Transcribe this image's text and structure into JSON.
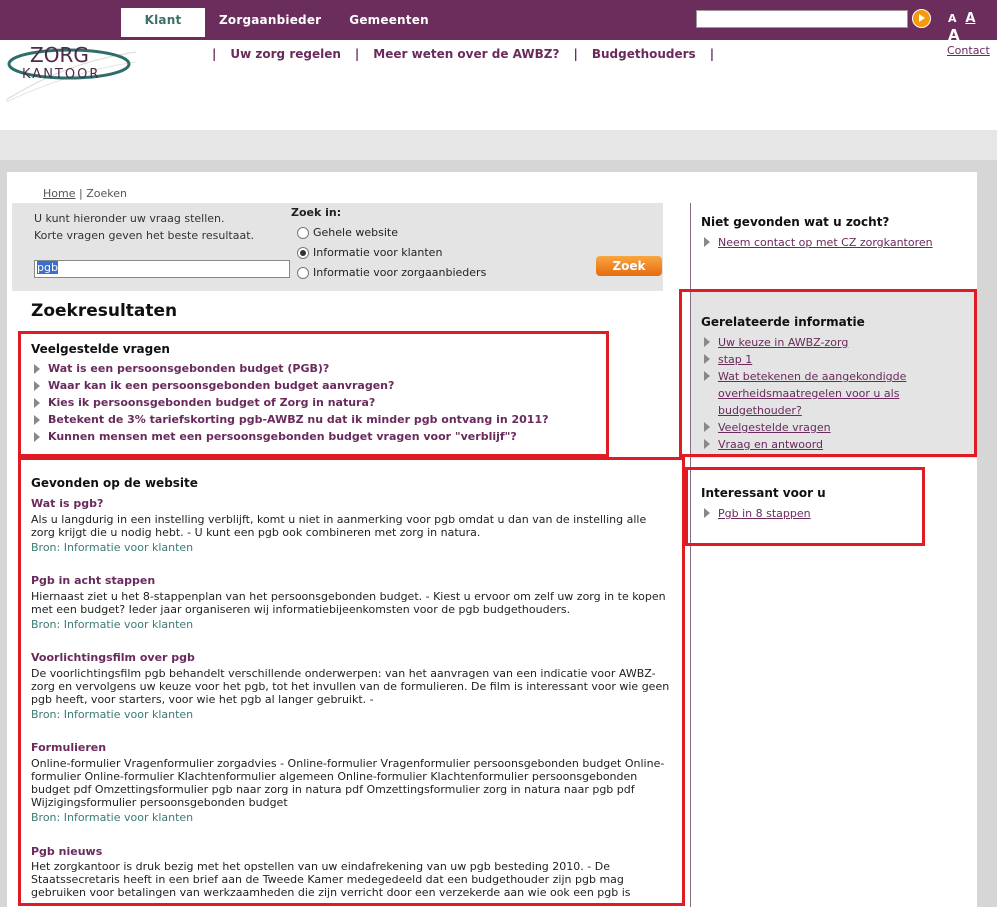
{
  "topnav": {
    "tabs": [
      "Klant",
      "Zorgaanbieder",
      "Gemeenten"
    ],
    "font_sizes": [
      "A",
      "A",
      "A"
    ]
  },
  "logo": {
    "line1": "ZORG",
    "line2": "KANTOOR"
  },
  "mainnav": {
    "items": [
      "Uw zorg regelen",
      "Meer weten over de AWBZ?",
      "Budgethouders"
    ],
    "separator": "|"
  },
  "contact": "Contact",
  "breadcrumb": {
    "home": "Home",
    "sep": "|",
    "current": "Zoeken"
  },
  "search": {
    "intro_line1": "U kunt hieronder uw vraag stellen.",
    "intro_line2": "Korte vragen geven het beste resultaat.",
    "query": "pgb",
    "zoek_in_label": "Zoek in:",
    "options": [
      "Gehele website",
      "Informatie voor klanten",
      "Informatie voor zorgaanbieders"
    ],
    "selected_option": "Informatie voor klanten",
    "button": "Zoek"
  },
  "results": {
    "title": "Zoekresultaten",
    "faq_title": "Veelgestelde vragen",
    "faq": [
      "Wat is een persoonsgebonden budget (PGB)?",
      "Waar kan ik een persoonsgebonden budget aanvragen?",
      "Kies ik persoonsgebonden budget of Zorg in natura?",
      "Betekent de 3% tariefskorting pgb-AWBZ nu dat ik minder pgb ontvang in 2011?",
      "Kunnen mensen met een persoonsgebonden budget vragen voor \"verblijf\"?"
    ],
    "website_title": "Gevonden op de website",
    "items": [
      {
        "title": "Wat is pgb?",
        "body": "Als u langdurig in een instelling verblijft, komt u niet in aanmerking voor pgb omdat u dan van de instelling alle zorg krijgt die u nodig hebt. - U kunt een pgb ook combineren met zorg in natura.",
        "source": "Bron: Informatie voor klanten"
      },
      {
        "title": "Pgb in acht stappen",
        "body": "Hiernaast ziet u het 8-stappenplan van het persoonsgebonden budget. - Kiest u ervoor om zelf uw zorg in te kopen met een budget? Ieder jaar organiseren wij informatiebijeenkomsten voor de pgb budgethouders.",
        "source": "Bron: Informatie voor klanten"
      },
      {
        "title": "Voorlichtingsfilm over pgb",
        "body": "De voorlichtingsfilm pgb behandelt verschillende onderwerpen: van het aanvragen van een indicatie voor AWBZ-zorg en vervolgens uw keuze voor het pgb, tot het invullen van de formulieren. De film is interessant voor wie geen pgb heeft, voor starters, voor wie het pgb al langer gebruikt. -",
        "source": "Bron: Informatie voor klanten"
      },
      {
        "title": "Formulieren",
        "body": "Online-formulier Vragenformulier zorgadvies - Online-formulier Vragenformulier persoonsgebonden budget Online-formulier Online-formulier Klachtenformulier algemeen Online-formulier Klachtenformulier persoonsgebonden budget pdf Omzettingsformulier pgb naar zorg in natura pdf Omzettingsformulier zorg in natura naar pgb pdf Wijzigingsformulier persoonsgebonden budget",
        "source": "Bron: Informatie voor klanten"
      },
      {
        "title": "Pgb nieuws",
        "body": "Het zorgkantoor is druk bezig met het opstellen van uw eindafrekening van uw pgb besteding 2010. - De Staatssecretaris heeft in een brief aan de Tweede Kamer medegedeeld dat een budgethouder zijn pgb mag gebruiken voor betalingen van werkzaamheden die zijn verricht door een verzekerde aan wie ook een pgb is verstrekt."
      }
    ]
  },
  "sidebar": {
    "notfound_title": "Niet gevonden wat u zocht?",
    "notfound_link": "Neem contact op met CZ zorgkantoren",
    "related_title": "Gerelateerde informatie",
    "related_links": [
      "Uw keuze in AWBZ-zorg",
      "stap 1",
      "Wat betekenen de aangekondigde overheidsmaatregelen voor u als budgethouder?",
      "Veelgestelde vragen",
      "Vraag en antwoord"
    ],
    "interesting_title": "Interessant voor u",
    "interesting_link": "Pgb in 8 stappen"
  },
  "colors": {
    "brand": "#6b2d5c",
    "accent": "#f59a0e",
    "highlight": "#e01b24",
    "source": "#3c7a75"
  }
}
